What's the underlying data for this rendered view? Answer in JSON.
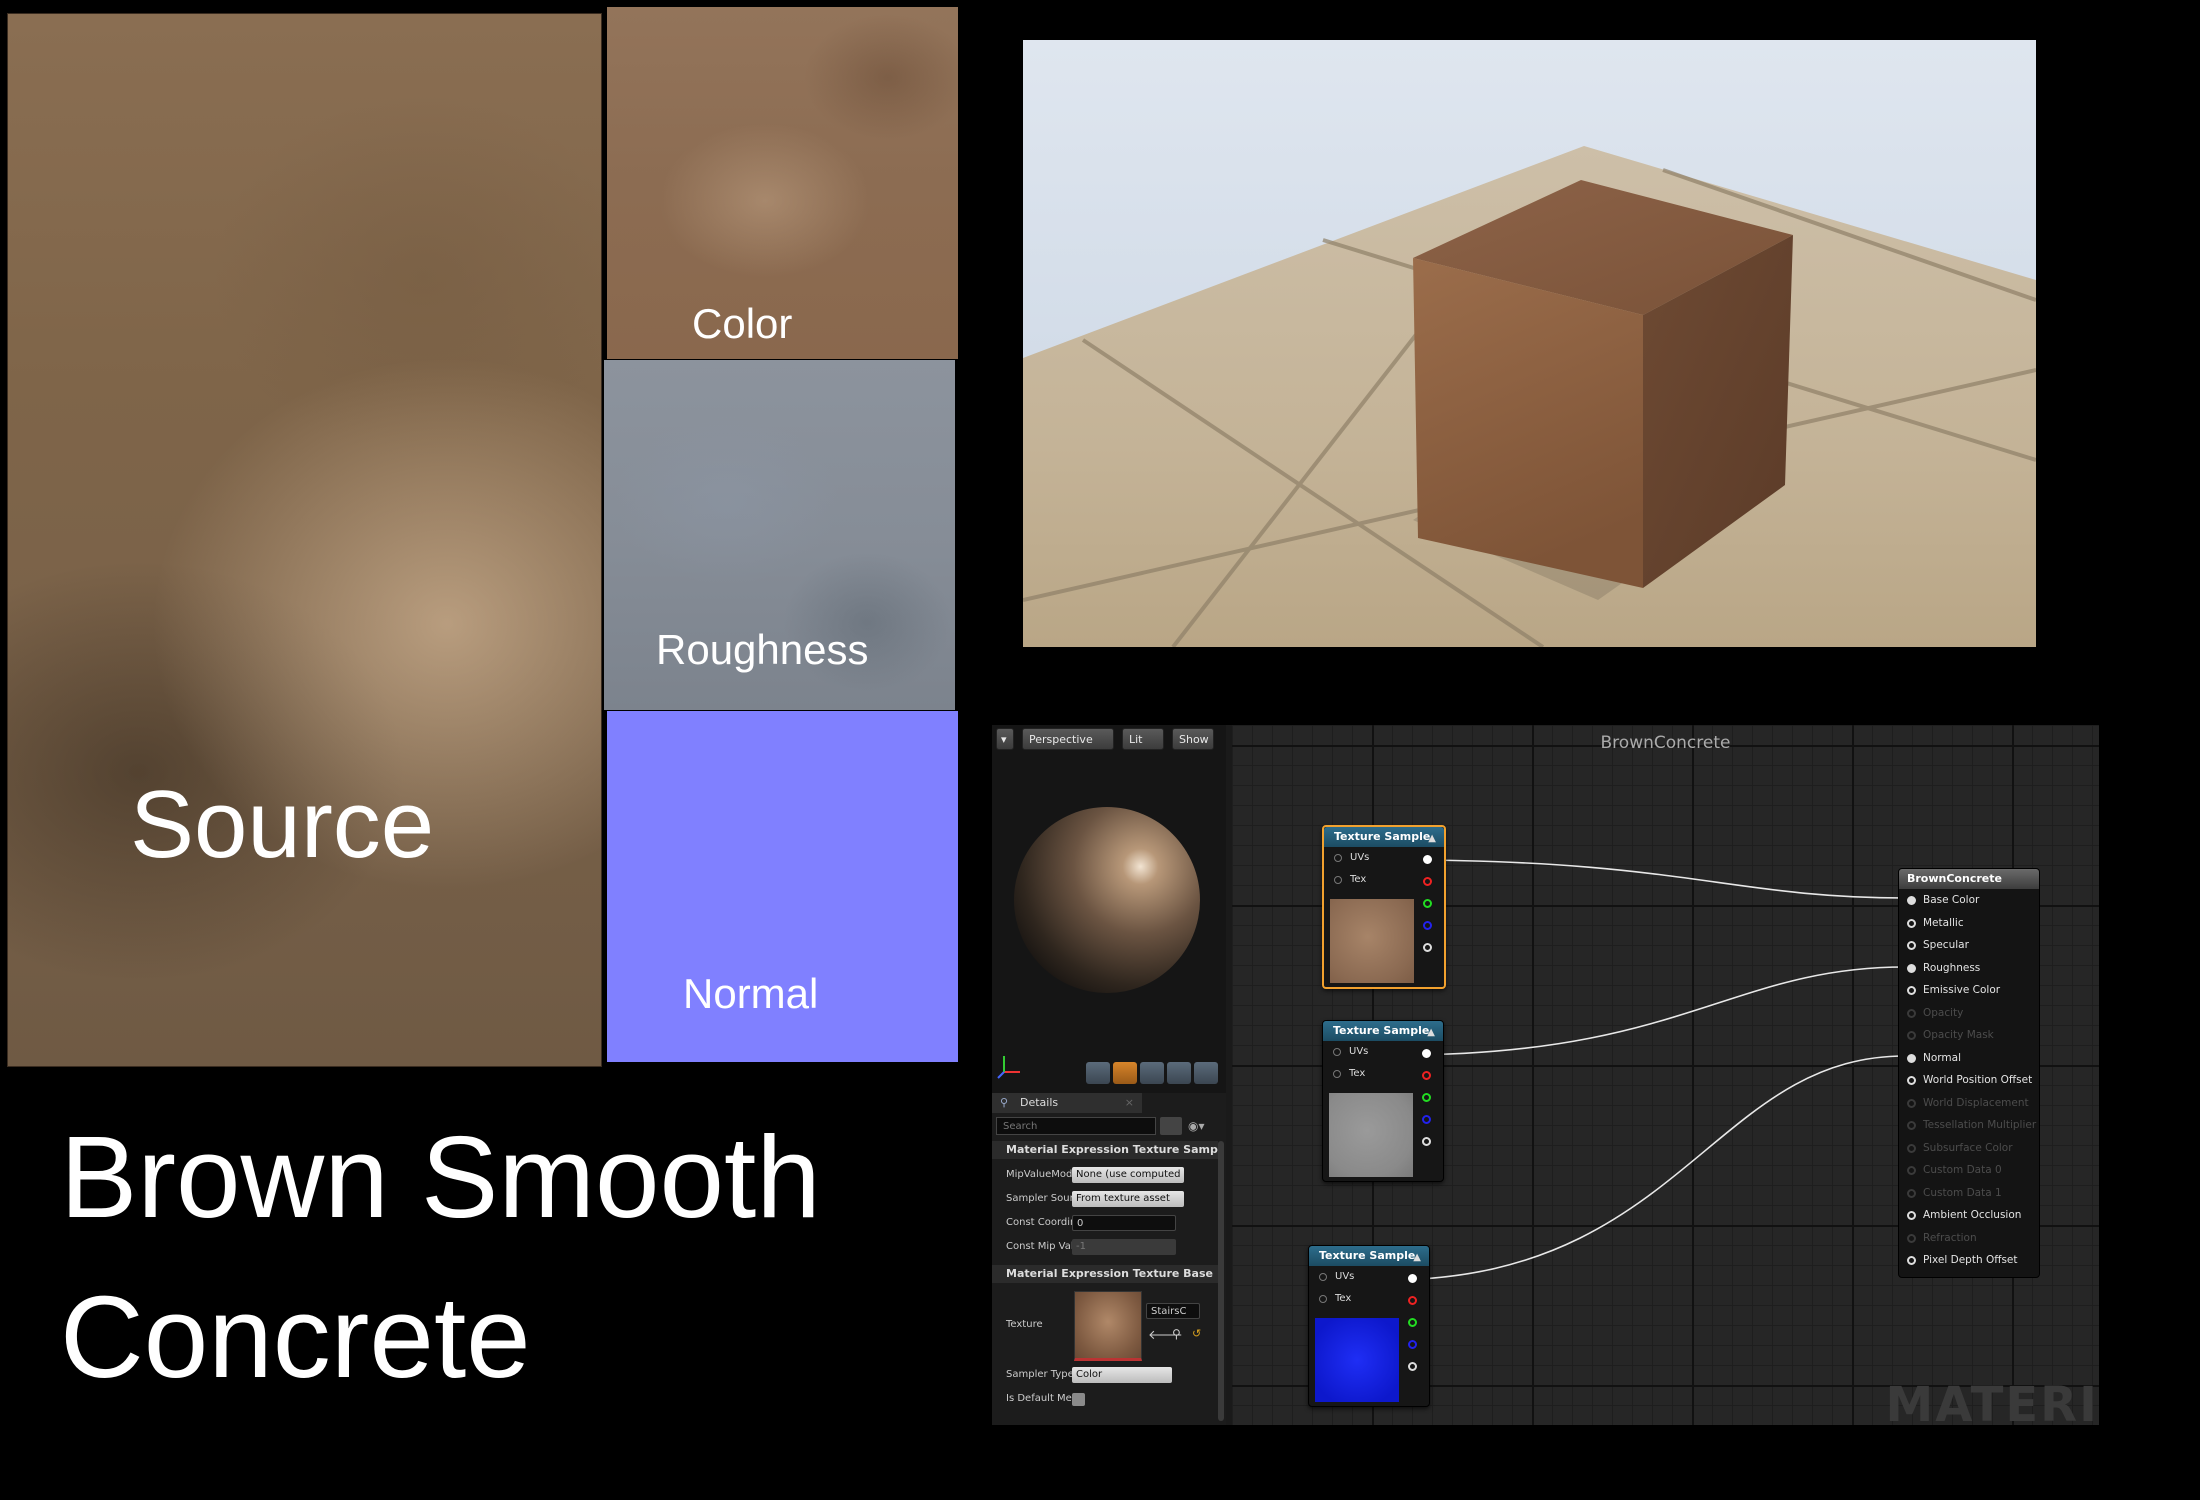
{
  "swatches": {
    "source_label": "Source",
    "color_label": "Color",
    "roughness_label": "Roughness",
    "normal_label": "Normal"
  },
  "title": {
    "line1": "Brown Smooth",
    "line2": "Concrete"
  },
  "toolbar": {
    "perspective": "Perspective",
    "lit": "Lit",
    "show": "Show"
  },
  "graph": {
    "title": "BrownConcrete",
    "watermark": "MATERI",
    "nodes": [
      {
        "title": "Texture Sample",
        "uvs": "UVs",
        "tex": "Tex"
      },
      {
        "title": "Texture Sample",
        "uvs": "UVs",
        "tex": "Tex"
      },
      {
        "title": "Texture Sample",
        "uvs": "UVs",
        "tex": "Tex"
      }
    ],
    "result_node": {
      "title": "BrownConcrete",
      "pins": [
        {
          "label": "Base Color",
          "active": true,
          "connected": true
        },
        {
          "label": "Metallic",
          "active": true,
          "connected": false
        },
        {
          "label": "Specular",
          "active": true,
          "connected": false
        },
        {
          "label": "Roughness",
          "active": true,
          "connected": true
        },
        {
          "label": "Emissive Color",
          "active": true,
          "connected": false
        },
        {
          "label": "Opacity",
          "active": false,
          "connected": false
        },
        {
          "label": "Opacity Mask",
          "active": false,
          "connected": false
        },
        {
          "label": "Normal",
          "active": true,
          "connected": true
        },
        {
          "label": "World Position Offset",
          "active": true,
          "connected": false
        },
        {
          "label": "World Displacement",
          "active": false,
          "connected": false
        },
        {
          "label": "Tessellation Multiplier",
          "active": false,
          "connected": false
        },
        {
          "label": "Subsurface Color",
          "active": false,
          "connected": false
        },
        {
          "label": "Custom Data 0",
          "active": false,
          "connected": false
        },
        {
          "label": "Custom Data 1",
          "active": false,
          "connected": false
        },
        {
          "label": "Ambient Occlusion",
          "active": true,
          "connected": false
        },
        {
          "label": "Refraction",
          "active": false,
          "connected": false
        },
        {
          "label": "Pixel Depth Offset",
          "active": true,
          "connected": false
        }
      ]
    }
  },
  "details": {
    "tab": "Details",
    "search_placeholder": "Search",
    "section1": "Material Expression Texture Sample",
    "rows1": [
      {
        "label": "MipValueMode",
        "value": "None (use computed mip level)"
      },
      {
        "label": "Sampler Source",
        "value": "From texture asset"
      },
      {
        "label": "Const Coordinate",
        "value": "0"
      },
      {
        "label": "Const Mip Value",
        "value": "-1"
      }
    ],
    "section2": "Material Expression Texture Base",
    "texture_label": "Texture",
    "texture_value": "StairsC",
    "sampler_type_label": "Sampler Type",
    "sampler_type_value": "Color",
    "is_default_label": "Is Default Meshpaint Texture"
  },
  "colors": {
    "normal_map": "#8080ff",
    "selection": "#f2a12e",
    "node_header": "#2d6d8c"
  }
}
